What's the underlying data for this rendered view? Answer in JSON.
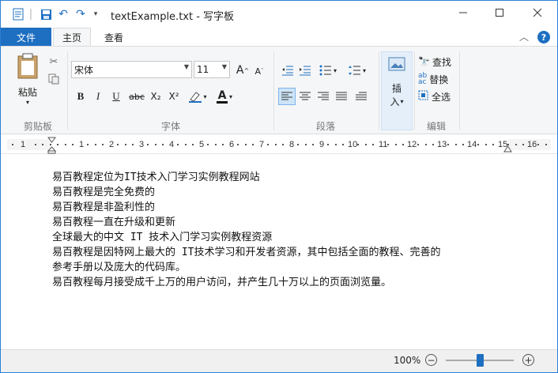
{
  "window": {
    "title": "textExample.txt - 写字板",
    "qat_icons": [
      "wordpad-app-icon",
      "save-icon",
      "undo-icon",
      "redo-icon",
      "customize-qat-icon"
    ],
    "controls": [
      "minimize-icon",
      "maximize-icon",
      "close-icon"
    ]
  },
  "menu": {
    "file": "文件",
    "home": "主页",
    "view": "查看"
  },
  "ribbon": {
    "clipboard": {
      "paste": "粘贴",
      "label": "剪贴板"
    },
    "font": {
      "family": "宋体",
      "size": "11",
      "bold": "B",
      "italic": "I",
      "underline": "U",
      "strike": "abc",
      "sub": "X₂",
      "sup": "X²",
      "color_letter": "A",
      "label": "字体"
    },
    "paragraph": {
      "label": "段落"
    },
    "insert": {
      "label_top": "插",
      "label_bottom": "入"
    },
    "editing": {
      "find": "查找",
      "replace": "替换",
      "select_all": "全选",
      "label": "编辑"
    }
  },
  "ruler": {
    "marks": [
      "1",
      "1",
      "2",
      "3",
      "4",
      "5",
      "6",
      "7",
      "8",
      "9",
      "10",
      "11",
      "12",
      "13",
      "14",
      "15",
      "16"
    ]
  },
  "document": {
    "lines": [
      "易百教程定位为IT技术入门学习实例教程网站",
      "易百教程是完全免费的",
      "易百教程是非盈利性的",
      "易百教程一直在升级和更新",
      "全球最大的中文 IT 技术入门学习实例教程资源",
      "易百教程是因特网上最大的 IT技术学习和开发者资源，其中包括全面的教程、完善的",
      "参考手册以及庞大的代码库。",
      "易百教程每月接受成千上万的用户访问，并产生几十万以上的页面浏览量。"
    ]
  },
  "status": {
    "zoom": "100%",
    "zoom_level": 0.5,
    "zoom_out": "−",
    "zoom_in": "+"
  },
  "colors": {
    "accent": "#1e6fc2",
    "ribbon_bg": "#f5f6f7"
  }
}
